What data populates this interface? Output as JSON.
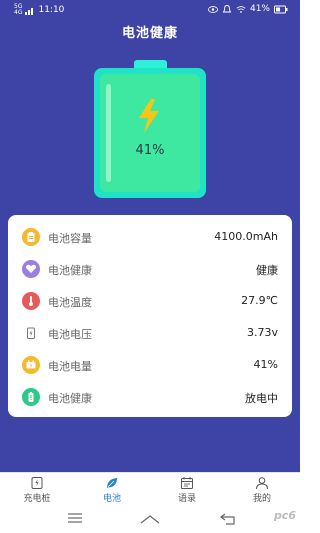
{
  "status_bar": {
    "network_top": "5G",
    "network_bottom": "4G",
    "time": "11:10",
    "battery": "41%"
  },
  "header": {
    "title": "电池健康"
  },
  "battery": {
    "percent_text": "41%",
    "level": 0.41
  },
  "info_rows": [
    {
      "icon": "clipboard-icon",
      "color": "#f5b92e",
      "label": "电池容量",
      "value": "4100.0mAh"
    },
    {
      "icon": "heart-icon",
      "color": "#9b7fe0",
      "label": "电池健康",
      "value": "健康"
    },
    {
      "icon": "thermometer-icon",
      "color": "#e85a5a",
      "label": "电池温度",
      "value": "27.9℃"
    },
    {
      "icon": "voltage-icon",
      "color": "#777777",
      "label": "电池电压",
      "value": "3.73v"
    },
    {
      "icon": "battery-level-icon",
      "color": "#f5b92e",
      "label": "电池电量",
      "value": "41%"
    },
    {
      "icon": "battery-status-icon",
      "color": "#2dc98a",
      "label": "电池健康",
      "value": "放电中"
    }
  ],
  "bottom_nav": [
    {
      "icon": "charger-icon",
      "label": "充电桩",
      "active": false
    },
    {
      "icon": "leaf-icon",
      "label": "电池",
      "active": true
    },
    {
      "icon": "calendar-icon",
      "label": "语录",
      "active": false
    },
    {
      "icon": "person-icon",
      "label": "我的",
      "active": false
    }
  ],
  "watermark": "pc6",
  "colors": {
    "background": "#3e44a5",
    "battery_body": "#1fe2c7",
    "battery_fill": "#3ee8a0",
    "bolt": "#f5c518",
    "active_tab": "#2a7fd6"
  }
}
